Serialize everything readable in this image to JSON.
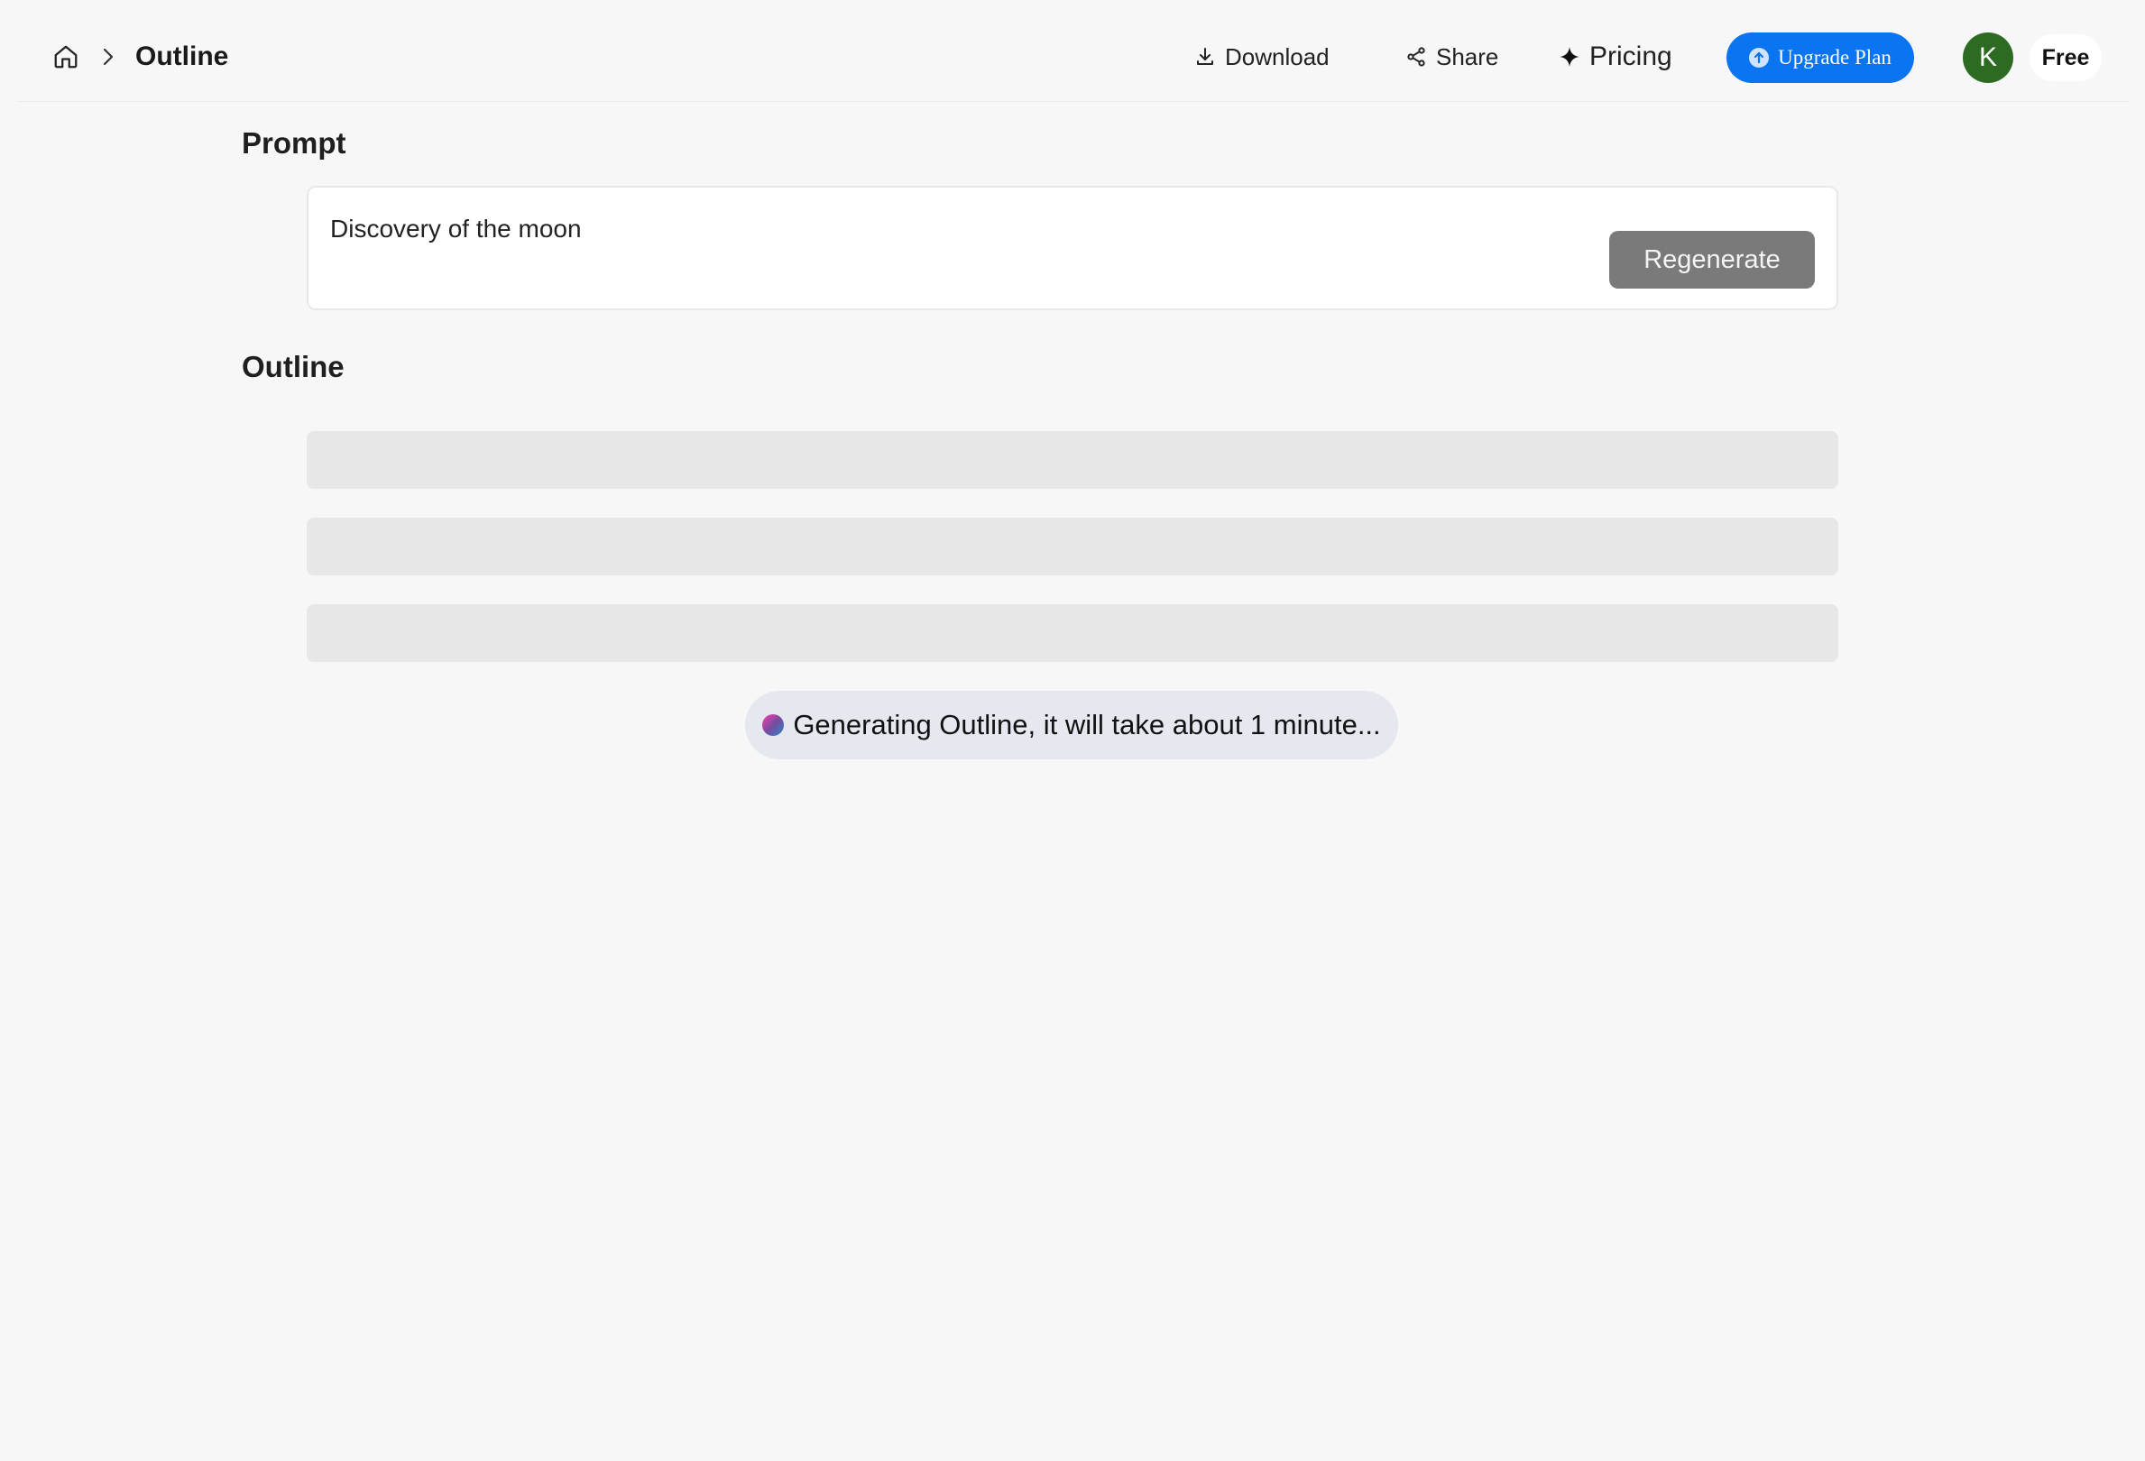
{
  "header": {
    "breadcrumb_title": "Outline",
    "download_label": "Download",
    "share_label": "Share",
    "pricing_label": "Pricing",
    "upgrade_label": "Upgrade Plan",
    "avatar_initial": "K",
    "plan_label": "Free"
  },
  "prompt": {
    "section_title": "Prompt",
    "text": "Discovery of the moon",
    "regenerate_label": "Regenerate"
  },
  "outline": {
    "section_title": "Outline",
    "status": "Generating Outline, it will take about 1 minute..."
  },
  "icons": [
    "home-icon",
    "chevron-right-icon",
    "download-icon",
    "share-icon",
    "sparkle-icon",
    "upgrade-arrow-icon"
  ],
  "colors": {
    "accent": "#0b74f0",
    "avatar": "#2e6b22",
    "regenerate_disabled": "#7a7a7a",
    "skeleton": "#e7e7e7",
    "status_pill": "#e6e8ef"
  }
}
